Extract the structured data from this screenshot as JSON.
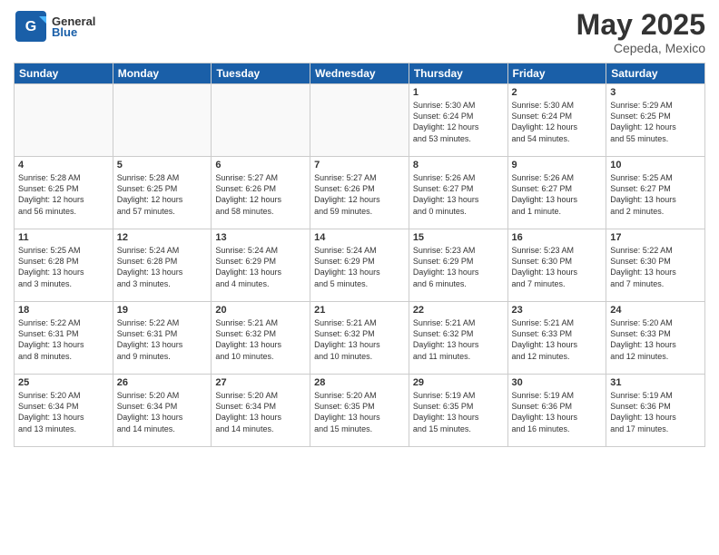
{
  "header": {
    "logo_general": "General",
    "logo_blue": "Blue",
    "title": "May 2025",
    "subtitle": "Cepeda, Mexico"
  },
  "days_of_week": [
    "Sunday",
    "Monday",
    "Tuesday",
    "Wednesday",
    "Thursday",
    "Friday",
    "Saturday"
  ],
  "weeks": [
    [
      {
        "day": "",
        "info": ""
      },
      {
        "day": "",
        "info": ""
      },
      {
        "day": "",
        "info": ""
      },
      {
        "day": "",
        "info": ""
      },
      {
        "day": "1",
        "info": "Sunrise: 5:30 AM\nSunset: 6:24 PM\nDaylight: 12 hours\nand 53 minutes."
      },
      {
        "day": "2",
        "info": "Sunrise: 5:30 AM\nSunset: 6:24 PM\nDaylight: 12 hours\nand 54 minutes."
      },
      {
        "day": "3",
        "info": "Sunrise: 5:29 AM\nSunset: 6:25 PM\nDaylight: 12 hours\nand 55 minutes."
      }
    ],
    [
      {
        "day": "4",
        "info": "Sunrise: 5:28 AM\nSunset: 6:25 PM\nDaylight: 12 hours\nand 56 minutes."
      },
      {
        "day": "5",
        "info": "Sunrise: 5:28 AM\nSunset: 6:25 PM\nDaylight: 12 hours\nand 57 minutes."
      },
      {
        "day": "6",
        "info": "Sunrise: 5:27 AM\nSunset: 6:26 PM\nDaylight: 12 hours\nand 58 minutes."
      },
      {
        "day": "7",
        "info": "Sunrise: 5:27 AM\nSunset: 6:26 PM\nDaylight: 12 hours\nand 59 minutes."
      },
      {
        "day": "8",
        "info": "Sunrise: 5:26 AM\nSunset: 6:27 PM\nDaylight: 13 hours\nand 0 minutes."
      },
      {
        "day": "9",
        "info": "Sunrise: 5:26 AM\nSunset: 6:27 PM\nDaylight: 13 hours\nand 1 minute."
      },
      {
        "day": "10",
        "info": "Sunrise: 5:25 AM\nSunset: 6:27 PM\nDaylight: 13 hours\nand 2 minutes."
      }
    ],
    [
      {
        "day": "11",
        "info": "Sunrise: 5:25 AM\nSunset: 6:28 PM\nDaylight: 13 hours\nand 3 minutes."
      },
      {
        "day": "12",
        "info": "Sunrise: 5:24 AM\nSunset: 6:28 PM\nDaylight: 13 hours\nand 3 minutes."
      },
      {
        "day": "13",
        "info": "Sunrise: 5:24 AM\nSunset: 6:29 PM\nDaylight: 13 hours\nand 4 minutes."
      },
      {
        "day": "14",
        "info": "Sunrise: 5:24 AM\nSunset: 6:29 PM\nDaylight: 13 hours\nand 5 minutes."
      },
      {
        "day": "15",
        "info": "Sunrise: 5:23 AM\nSunset: 6:29 PM\nDaylight: 13 hours\nand 6 minutes."
      },
      {
        "day": "16",
        "info": "Sunrise: 5:23 AM\nSunset: 6:30 PM\nDaylight: 13 hours\nand 7 minutes."
      },
      {
        "day": "17",
        "info": "Sunrise: 5:22 AM\nSunset: 6:30 PM\nDaylight: 13 hours\nand 7 minutes."
      }
    ],
    [
      {
        "day": "18",
        "info": "Sunrise: 5:22 AM\nSunset: 6:31 PM\nDaylight: 13 hours\nand 8 minutes."
      },
      {
        "day": "19",
        "info": "Sunrise: 5:22 AM\nSunset: 6:31 PM\nDaylight: 13 hours\nand 9 minutes."
      },
      {
        "day": "20",
        "info": "Sunrise: 5:21 AM\nSunset: 6:32 PM\nDaylight: 13 hours\nand 10 minutes."
      },
      {
        "day": "21",
        "info": "Sunrise: 5:21 AM\nSunset: 6:32 PM\nDaylight: 13 hours\nand 10 minutes."
      },
      {
        "day": "22",
        "info": "Sunrise: 5:21 AM\nSunset: 6:32 PM\nDaylight: 13 hours\nand 11 minutes."
      },
      {
        "day": "23",
        "info": "Sunrise: 5:21 AM\nSunset: 6:33 PM\nDaylight: 13 hours\nand 12 minutes."
      },
      {
        "day": "24",
        "info": "Sunrise: 5:20 AM\nSunset: 6:33 PM\nDaylight: 13 hours\nand 12 minutes."
      }
    ],
    [
      {
        "day": "25",
        "info": "Sunrise: 5:20 AM\nSunset: 6:34 PM\nDaylight: 13 hours\nand 13 minutes."
      },
      {
        "day": "26",
        "info": "Sunrise: 5:20 AM\nSunset: 6:34 PM\nDaylight: 13 hours\nand 14 minutes."
      },
      {
        "day": "27",
        "info": "Sunrise: 5:20 AM\nSunset: 6:34 PM\nDaylight: 13 hours\nand 14 minutes."
      },
      {
        "day": "28",
        "info": "Sunrise: 5:20 AM\nSunset: 6:35 PM\nDaylight: 13 hours\nand 15 minutes."
      },
      {
        "day": "29",
        "info": "Sunrise: 5:19 AM\nSunset: 6:35 PM\nDaylight: 13 hours\nand 15 minutes."
      },
      {
        "day": "30",
        "info": "Sunrise: 5:19 AM\nSunset: 6:36 PM\nDaylight: 13 hours\nand 16 minutes."
      },
      {
        "day": "31",
        "info": "Sunrise: 5:19 AM\nSunset: 6:36 PM\nDaylight: 13 hours\nand 17 minutes."
      }
    ]
  ]
}
